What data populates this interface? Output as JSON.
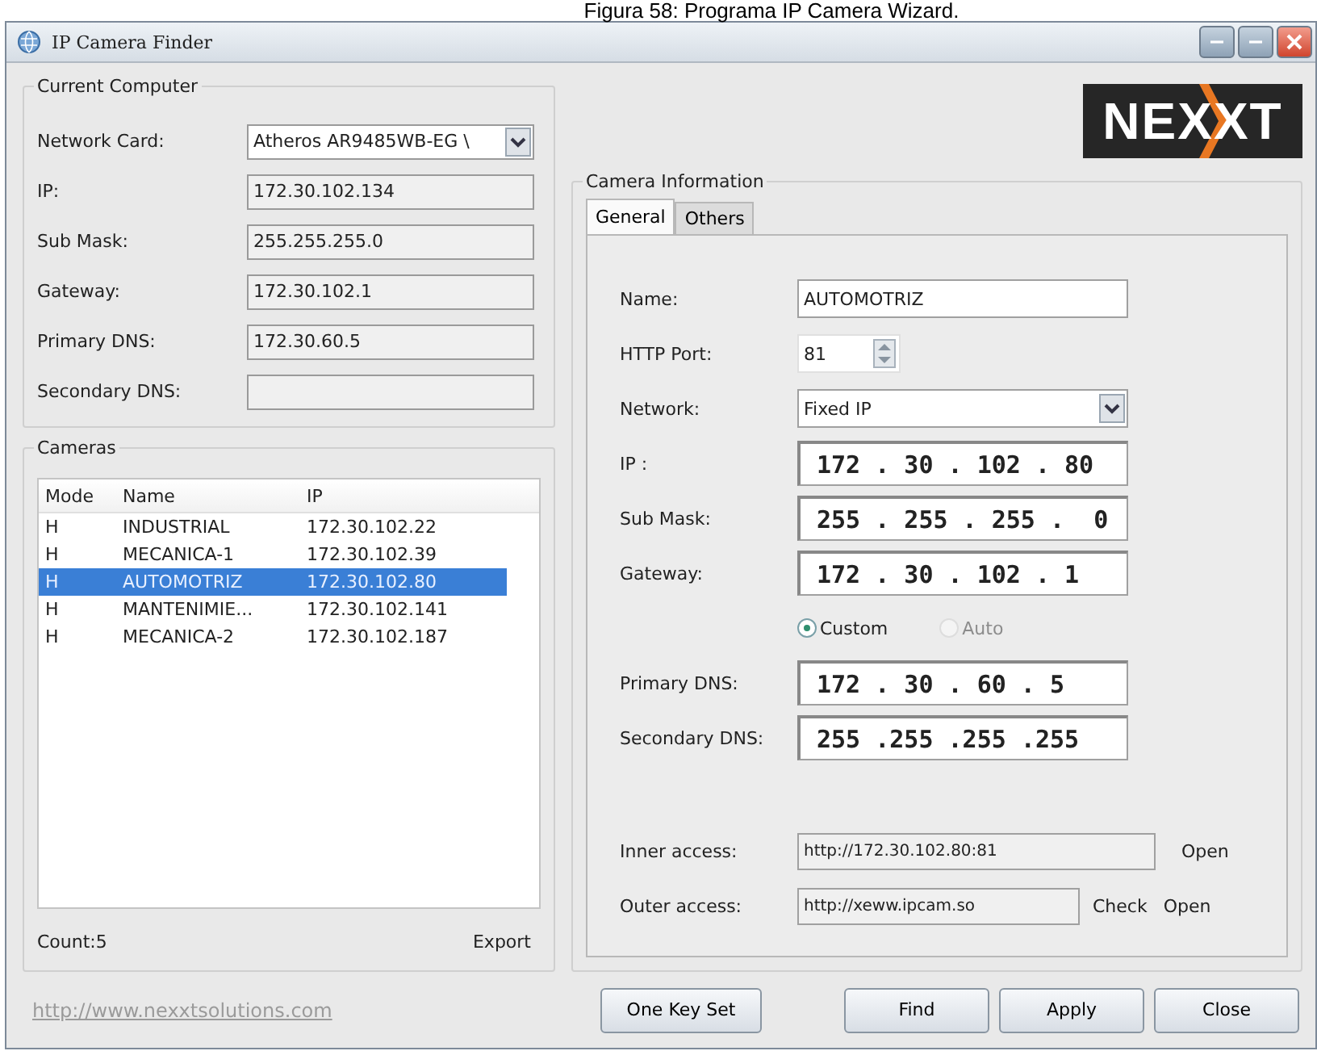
{
  "caption": "Figura 58: Programa IP Camera Wizard.",
  "window": {
    "title": "IP Camera Finder"
  },
  "current_computer": {
    "title": "Current Computer",
    "rows": [
      {
        "kind": "select",
        "label": "Network Card:",
        "value": "Atheros AR9485WB-EG \\"
      },
      {
        "kind": "text",
        "label": "IP:",
        "value": "172.30.102.134"
      },
      {
        "kind": "text",
        "label": "Sub Mask:",
        "value": "255.255.255.0"
      },
      {
        "kind": "text",
        "label": "Gateway:",
        "value": "172.30.102.1"
      },
      {
        "kind": "text",
        "label": "Primary DNS:",
        "value": "172.30.60.5"
      },
      {
        "kind": "text",
        "label": "Secondary DNS:"
      }
    ]
  },
  "cameras": {
    "title": "Cameras",
    "columns": [
      "Mode",
      "Name",
      "IP"
    ],
    "rows": [
      {
        "cells": [
          "H",
          "INDUSTRIAL",
          "172.30.102.22"
        ],
        "selected": false
      },
      {
        "cells": [
          "H",
          "MECANICA-1",
          "172.30.102.39"
        ],
        "selected": false
      },
      {
        "cells": [
          "H",
          "AUTOMOTRIZ",
          "172.30.102.80"
        ],
        "selected": true
      },
      {
        "cells": [
          "H",
          "MANTENIMIE...",
          "172.30.102.141"
        ],
        "selected": false
      },
      {
        "cells": [
          "H",
          "MECANICA-2",
          "172.30.102.187"
        ],
        "selected": false
      }
    ],
    "count": "Count:5",
    "export": "Export"
  },
  "website": "http://www.nexxtsolutions.com",
  "logo": "NEXXT",
  "camera_info": {
    "title": "Camera Information",
    "tabs": [
      {
        "label": "General",
        "selected": true
      },
      {
        "label": "Others",
        "selected": false
      }
    ],
    "rows": [
      {
        "kind": "text",
        "label": "Name:",
        "value": "AUTOMOTRIZ"
      },
      {
        "kind": "spin",
        "label": "HTTP Port:",
        "value": "81"
      },
      {
        "kind": "select",
        "label": "Network:",
        "value": "Fixed IP"
      },
      {
        "kind": "ip",
        "label": "IP :",
        "value": "172 . 30 . 102 . 80"
      },
      {
        "kind": "ip",
        "label": "Sub Mask:",
        "value": "255 . 255 . 255 .  0"
      },
      {
        "kind": "ip",
        "label": "Gateway:",
        "value": "172 . 30 . 102 . 1"
      },
      {
        "kind": "radios",
        "options": [
          {
            "label": "Custom",
            "selected": true,
            "disabled": false
          },
          {
            "label": "Auto",
            "selected": false,
            "disabled": true
          }
        ]
      },
      {
        "kind": "ip",
        "label": "Primary DNS:",
        "value": "172 . 30 . 60 . 5"
      },
      {
        "kind": "ip",
        "label": "Secondary DNS:",
        "value": "255 .255 .255 .255"
      },
      {
        "kind": "gap"
      },
      {
        "kind": "access",
        "label": "Inner access:",
        "value": "http://172.30.102.80:81",
        "links": [
          "Open"
        ]
      },
      {
        "kind": "access",
        "label": "Outer access:",
        "value": "http://xeww.ipcam.so",
        "links": [
          "Check",
          "Open"
        ]
      }
    ]
  },
  "buttons_left": [
    "One Key Set"
  ],
  "buttons_right": [
    "Find",
    "Apply",
    "Close"
  ]
}
